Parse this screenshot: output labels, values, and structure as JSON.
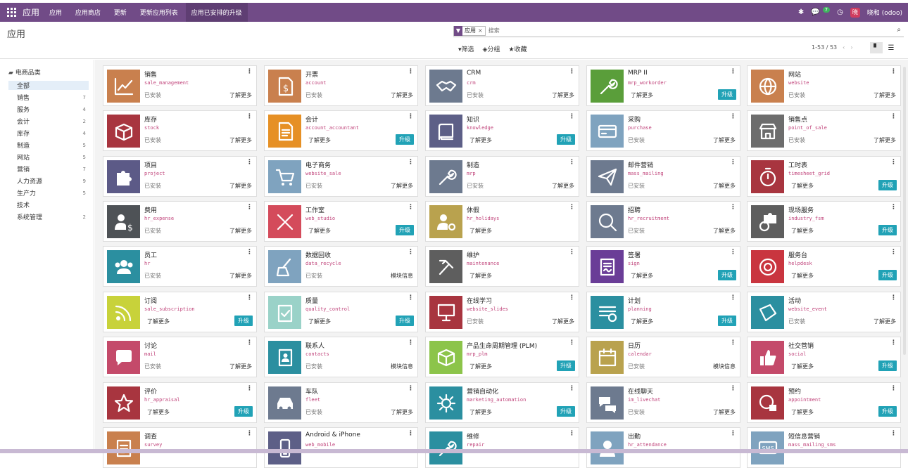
{
  "topbar": {
    "brand": "应用",
    "menu": [
      "应用",
      "应用商店",
      "更新",
      "更新应用列表",
      "应用已安排的升级"
    ],
    "active_menu": 4,
    "messages_count": "7",
    "avatar_letter": "晓",
    "user": "晓和 (odoo)",
    "bg_color": "#714b87"
  },
  "control_panel": {
    "title": "应用",
    "facet_label": "应用",
    "search_placeholder": "搜索",
    "filters_label": "筛选",
    "group_label": "分组",
    "favorites_label": "收藏",
    "pager": "1-53 / 53"
  },
  "sidebar": {
    "header": "电商品类",
    "items": [
      {
        "label": "全部",
        "count": ""
      },
      {
        "label": "销售",
        "count": "7"
      },
      {
        "label": "服务",
        "count": "4"
      },
      {
        "label": "会计",
        "count": "2"
      },
      {
        "label": "库存",
        "count": "4"
      },
      {
        "label": "制造",
        "count": "5"
      },
      {
        "label": "网站",
        "count": "5"
      },
      {
        "label": "营销",
        "count": "7"
      },
      {
        "label": "人力资源",
        "count": "9"
      },
      {
        "label": "生产力",
        "count": "5"
      },
      {
        "label": "技术",
        "count": ""
      },
      {
        "label": "系统管理",
        "count": "2"
      }
    ]
  },
  "labels": {
    "installed": "已安装",
    "learn_more": "了解更多",
    "module_info": "模块信息",
    "upgrade": "升级"
  },
  "apps": [
    {
      "name": "销售",
      "tech": "sale_management",
      "color": "#c9804e",
      "icon": "chart-up-icon",
      "installed": true,
      "action": "learn"
    },
    {
      "name": "开票",
      "tech": "account",
      "color": "#c9804e",
      "icon": "invoice-icon",
      "installed": true,
      "action": "learn"
    },
    {
      "name": "CRM",
      "tech": "crm",
      "color": "#6d7a8f",
      "icon": "handshake-icon",
      "installed": true,
      "action": "learn"
    },
    {
      "name": "MRP II",
      "tech": "mrp_workorder",
      "color": "#5a9e3a",
      "icon": "wrench-icon",
      "installed": false,
      "action": "upgrade"
    },
    {
      "name": "网站",
      "tech": "website",
      "color": "#c9804e",
      "icon": "globe-icon",
      "installed": true,
      "action": "learn"
    },
    {
      "name": "库存",
      "tech": "stock",
      "color": "#a8353f",
      "icon": "box-icon",
      "installed": true,
      "action": "learn"
    },
    {
      "name": "会计",
      "tech": "account_accountant",
      "color": "#e69025",
      "icon": "document-icon",
      "installed": false,
      "action": "upgrade"
    },
    {
      "name": "知识",
      "tech": "knowledge",
      "color": "#5d5f87",
      "icon": "book-icon",
      "installed": false,
      "action": "upgrade"
    },
    {
      "name": "采购",
      "tech": "purchase",
      "color": "#7fa3bf",
      "icon": "card-icon",
      "installed": true,
      "action": "learn"
    },
    {
      "name": "销售点",
      "tech": "point_of_sale",
      "color": "#6d6d6d",
      "icon": "shop-icon",
      "installed": true,
      "action": "learn"
    },
    {
      "name": "项目",
      "tech": "project",
      "color": "#5c5a87",
      "icon": "puzzle-icon",
      "installed": true,
      "action": "learn"
    },
    {
      "name": "电子商务",
      "tech": "website_sale",
      "color": "#7fa3bf",
      "icon": "cart-icon",
      "installed": true,
      "action": "learn"
    },
    {
      "name": "制造",
      "tech": "mrp",
      "color": "#6d7a8f",
      "icon": "wrench-icon",
      "installed": true,
      "action": "learn"
    },
    {
      "name": "邮件营销",
      "tech": "mass_mailing",
      "color": "#6d7a8f",
      "icon": "paper-plane-icon",
      "installed": true,
      "action": "learn"
    },
    {
      "name": "工时表",
      "tech": "timesheet_grid",
      "color": "#a8353f",
      "icon": "stopwatch-icon",
      "installed": false,
      "action": "upgrade"
    },
    {
      "name": "费用",
      "tech": "hr_expense",
      "color": "#4e5256",
      "icon": "user-dollar-icon",
      "installed": true,
      "action": "learn"
    },
    {
      "name": "工作室",
      "tech": "web_studio",
      "color": "#d44b5b",
      "icon": "tools-icon",
      "installed": false,
      "action": "upgrade"
    },
    {
      "name": "休假",
      "tech": "hr_holidays",
      "color": "#b9a24e",
      "icon": "user-gear-icon",
      "installed": false,
      "action": "learn"
    },
    {
      "name": "招聘",
      "tech": "hr_recruitment",
      "color": "#6d7a8f",
      "icon": "magnifier-icon",
      "installed": true,
      "action": "learn"
    },
    {
      "name": "现场服务",
      "tech": "industry_fsm",
      "color": "#5e5e5e",
      "icon": "puzzle-clock-icon",
      "installed": false,
      "action": "upgrade"
    },
    {
      "name": "员工",
      "tech": "hr",
      "color": "#2b8fa0",
      "icon": "users-icon",
      "installed": true,
      "action": "learn"
    },
    {
      "name": "数据回收",
      "tech": "data_recycle",
      "color": "#7fa3bf",
      "icon": "broom-icon",
      "installed": true,
      "action": "info"
    },
    {
      "name": "维护",
      "tech": "maintenance",
      "color": "#5e5e5e",
      "icon": "hammer-icon",
      "installed": false,
      "action": "learn"
    },
    {
      "name": "签署",
      "tech": "sign",
      "color": "#6a3d97",
      "icon": "sign-icon",
      "installed": false,
      "action": "upgrade"
    },
    {
      "name": "服务台",
      "tech": "helpdesk",
      "color": "#c9353f",
      "icon": "lifebuoy-icon",
      "installed": false,
      "action": "upgrade"
    },
    {
      "name": "订阅",
      "tech": "sale_subscription",
      "color": "#c8d23a",
      "icon": "rss-icon",
      "installed": false,
      "action": "upgrade"
    },
    {
      "name": "质量",
      "tech": "quality_control",
      "color": "#9ad2c8",
      "icon": "clipboard-check-icon",
      "installed": false,
      "action": "upgrade"
    },
    {
      "name": "在线学习",
      "tech": "website_slides",
      "color": "#a8353f",
      "icon": "presentation-icon",
      "installed": true,
      "action": "learn"
    },
    {
      "name": "计划",
      "tech": "planning",
      "color": "#2b8fa0",
      "icon": "list-clock-icon",
      "installed": false,
      "action": "upgrade"
    },
    {
      "name": "活动",
      "tech": "website_event",
      "color": "#2b8fa0",
      "icon": "ticket-icon",
      "installed": true,
      "action": "learn"
    },
    {
      "name": "讨论",
      "tech": "mail",
      "color": "#c44a6a",
      "icon": "chat-icon",
      "installed": true,
      "action": "learn"
    },
    {
      "name": "联系人",
      "tech": "contacts",
      "color": "#2b8fa0",
      "icon": "address-book-icon",
      "installed": true,
      "action": "info"
    },
    {
      "name": "产品生命周期管理 (PLM)",
      "tech": "mrp_plm",
      "color": "#8cc44a",
      "icon": "cube-icon",
      "installed": false,
      "action": "upgrade"
    },
    {
      "name": "日历",
      "tech": "calendar",
      "color": "#b9a24e",
      "icon": "calendar-icon",
      "installed": true,
      "action": "info"
    },
    {
      "name": "社交营销",
      "tech": "social",
      "color": "#c44a6a",
      "icon": "thumbs-up-icon",
      "installed": false,
      "action": "upgrade"
    },
    {
      "name": "评价",
      "tech": "hr_appraisal",
      "color": "#a8353f",
      "icon": "star-icon",
      "installed": false,
      "action": "upgrade"
    },
    {
      "name": "车队",
      "tech": "fleet",
      "color": "#6d7a8f",
      "icon": "car-icon",
      "installed": true,
      "action": "learn"
    },
    {
      "name": "营销自动化",
      "tech": "marketing_automation",
      "color": "#2b8fa0",
      "icon": "gear-icon",
      "installed": false,
      "action": "upgrade"
    },
    {
      "name": "在线聊天",
      "tech": "im_livechat",
      "color": "#6d7a8f",
      "icon": "chat-bubbles-icon",
      "installed": true,
      "action": "learn"
    },
    {
      "name": "预约",
      "tech": "appointment",
      "color": "#a8353f",
      "icon": "globe-calendar-icon",
      "installed": false,
      "action": "upgrade"
    },
    {
      "name": "调查",
      "tech": "survey",
      "color": "#c9804e",
      "icon": "survey-icon",
      "installed": false,
      "action": "none"
    },
    {
      "name": "Android & iPhone",
      "tech": "web_mobile",
      "color": "#5d5f87",
      "icon": "mobile-icon",
      "installed": false,
      "action": "none"
    },
    {
      "name": "维修",
      "tech": "repair",
      "color": "#2b8fa0",
      "icon": "wrench-icon",
      "installed": false,
      "action": "none"
    },
    {
      "name": "出勤",
      "tech": "hr_attendance",
      "color": "#7fa3bf",
      "icon": "user-icon",
      "installed": false,
      "action": "none"
    },
    {
      "name": "短信息营销",
      "tech": "mass_mailing_sms",
      "color": "#7fa3bf",
      "icon": "sms-icon",
      "installed": false,
      "action": "none"
    }
  ]
}
